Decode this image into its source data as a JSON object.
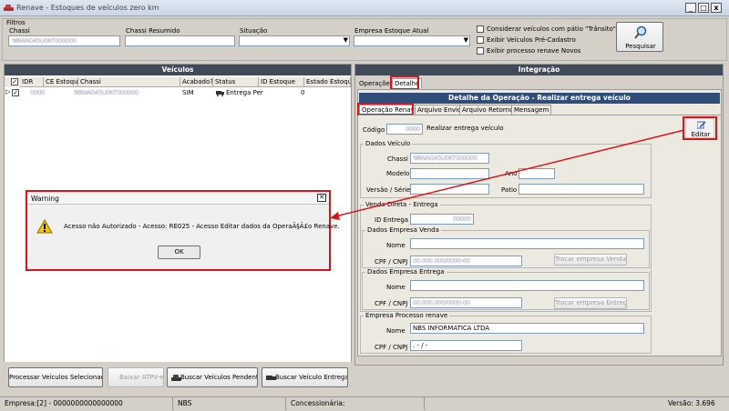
{
  "window": {
    "title": "Renave - Estoques de veículos zero km",
    "min": "_",
    "max": "□",
    "close": "x"
  },
  "filters": {
    "group_label": "Filtros",
    "chassi_label": "Chassi",
    "chassi_value": "9BWAG45U0KT000000",
    "chassi_resumido_label": "Chassi Resumido",
    "situacao_label": "Situação",
    "empresa_label": "Empresa Estoque Atual",
    "check_transito": "Considerar veículos com pátio \"Trânsito\"",
    "check_precadastro": "Exibir Veículos Pré-Cadastro",
    "check_novos": "Exibir processo renave Novos",
    "search_button": "Pesquisar"
  },
  "vehicles": {
    "header": "Veículos",
    "columns": [
      "IDR",
      "CE Estoque",
      "Chassi",
      "Acabado?",
      "Status",
      "ID Estoque",
      "Estado Estoque"
    ],
    "rows": [
      {
        "idr": "0000",
        "ce": "",
        "chassi": "9BWAG45U0KT000000",
        "acabado": "SIM",
        "status": "Entrega Per",
        "id_estoque": "0",
        "estado": ""
      }
    ]
  },
  "integration": {
    "header": "Integração",
    "tabs": [
      "Operações",
      "Detalhe"
    ],
    "detail_header": "Detalhe da Operação - Realizar entrega veículo",
    "subtabs": [
      "Operação Renave",
      "Arquivo Envio",
      "Arquivo Retorno",
      "Mensagem"
    ],
    "codigo_label": "Código",
    "codigo_value": "0000",
    "codigo_desc": "Realizar entrega veículo",
    "edit_button": "Editar",
    "dados_veiculo": {
      "title": "Dados Veículo",
      "chassi_label": "Chassi",
      "chassi_value": "9BWAG45U0KT000000",
      "modelo_label": "Modelo",
      "ano_label": "Ano",
      "versao_label": "Versão / Série",
      "patio_label": "Patio"
    },
    "venda_direta": {
      "title": "Venda Direta - Entrega",
      "id_label": "ID Entrega",
      "id_value": "00000",
      "empresa_venda_title": "Dados Empresa Venda",
      "nome_label": "Nome",
      "cpf_label": "CPF / CNPJ",
      "cpf_value_venda": "00.000.000/0000-00",
      "trocar_venda": "Trocar empresa Venda",
      "empresa_entrega_title": "Dados Empresa Entrega",
      "cpf_value_entrega": "00.000.000/0000-00",
      "trocar_entrega": "Trocar empresa Entrega"
    },
    "processo": {
      "title": "Empresa Processo renave",
      "nome_label": "Nome",
      "nome_value": "NBS INFORMATICA LTDA",
      "cpf_label": "CPF / CNPJ",
      "cpf_value": ". - / -"
    }
  },
  "warning": {
    "title": "Warning",
    "message": "Acesso não Autorizado - Acesso: RE025 - Acesso Editar dados da OperaÃ§Ã£o Renave.",
    "ok": "OK"
  },
  "bottom_buttons": {
    "processar": "Processar Veículos Selecionados",
    "baixar": "Baixar ATPV-e",
    "pendentes": "Buscar Veículos Pendentes",
    "entrega": "Buscar Veículo Entrega"
  },
  "status_bar": {
    "empresa": "Empresa:[2] - 0000000000000000",
    "nbs": "NBS",
    "concessionaria": "Concessionária:",
    "versao": "Versão: 3.696"
  },
  "colors": {
    "highlight": "#d9141a",
    "panel_dark": "#404a58",
    "panel_blue": "#2f4d78"
  }
}
